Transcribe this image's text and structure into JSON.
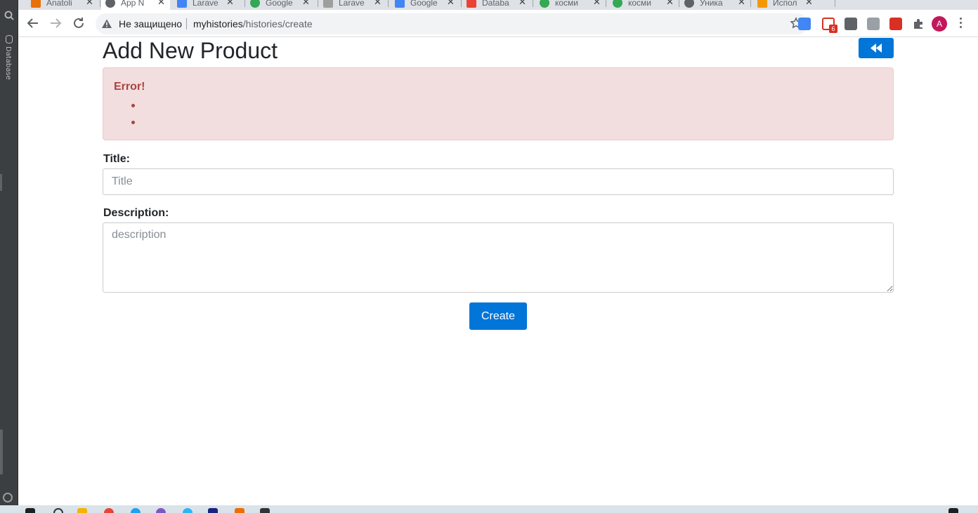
{
  "ide": {
    "database_tab_label": "Database"
  },
  "browser": {
    "tabs": [
      {
        "label": "Anatoli",
        "active": false
      },
      {
        "label": "App N",
        "active": true
      },
      {
        "label": "Larave",
        "active": false
      },
      {
        "label": "Google",
        "active": false
      },
      {
        "label": "Larave",
        "active": false
      },
      {
        "label": "Google",
        "active": false
      },
      {
        "label": "Databa",
        "active": false
      },
      {
        "label": "косми",
        "active": false
      },
      {
        "label": "косми",
        "active": false
      },
      {
        "label": "Уника",
        "active": false
      },
      {
        "label": "Испол",
        "active": false
      }
    ],
    "security_label": "Не защищено",
    "url_host": "myhistories",
    "url_path": "/histories/create",
    "gmail_badge": "6",
    "profile_initial": "A",
    "colors": {
      "profile": "#c2185b",
      "gmail": "#d93025"
    }
  },
  "page": {
    "title": "Add New Product",
    "back_button_icon": "backward-icon",
    "alert": {
      "title": "Error!",
      "items": [
        "",
        ""
      ]
    },
    "form": {
      "title_label": "Title:",
      "title_placeholder": "Title",
      "title_value": "",
      "description_label": "Description:",
      "description_placeholder": "description",
      "description_value": "",
      "submit_label": "Create"
    },
    "colors": {
      "primary": "#0275d8",
      "alert_bg": "#f2dede",
      "alert_text": "#a94442"
    }
  }
}
